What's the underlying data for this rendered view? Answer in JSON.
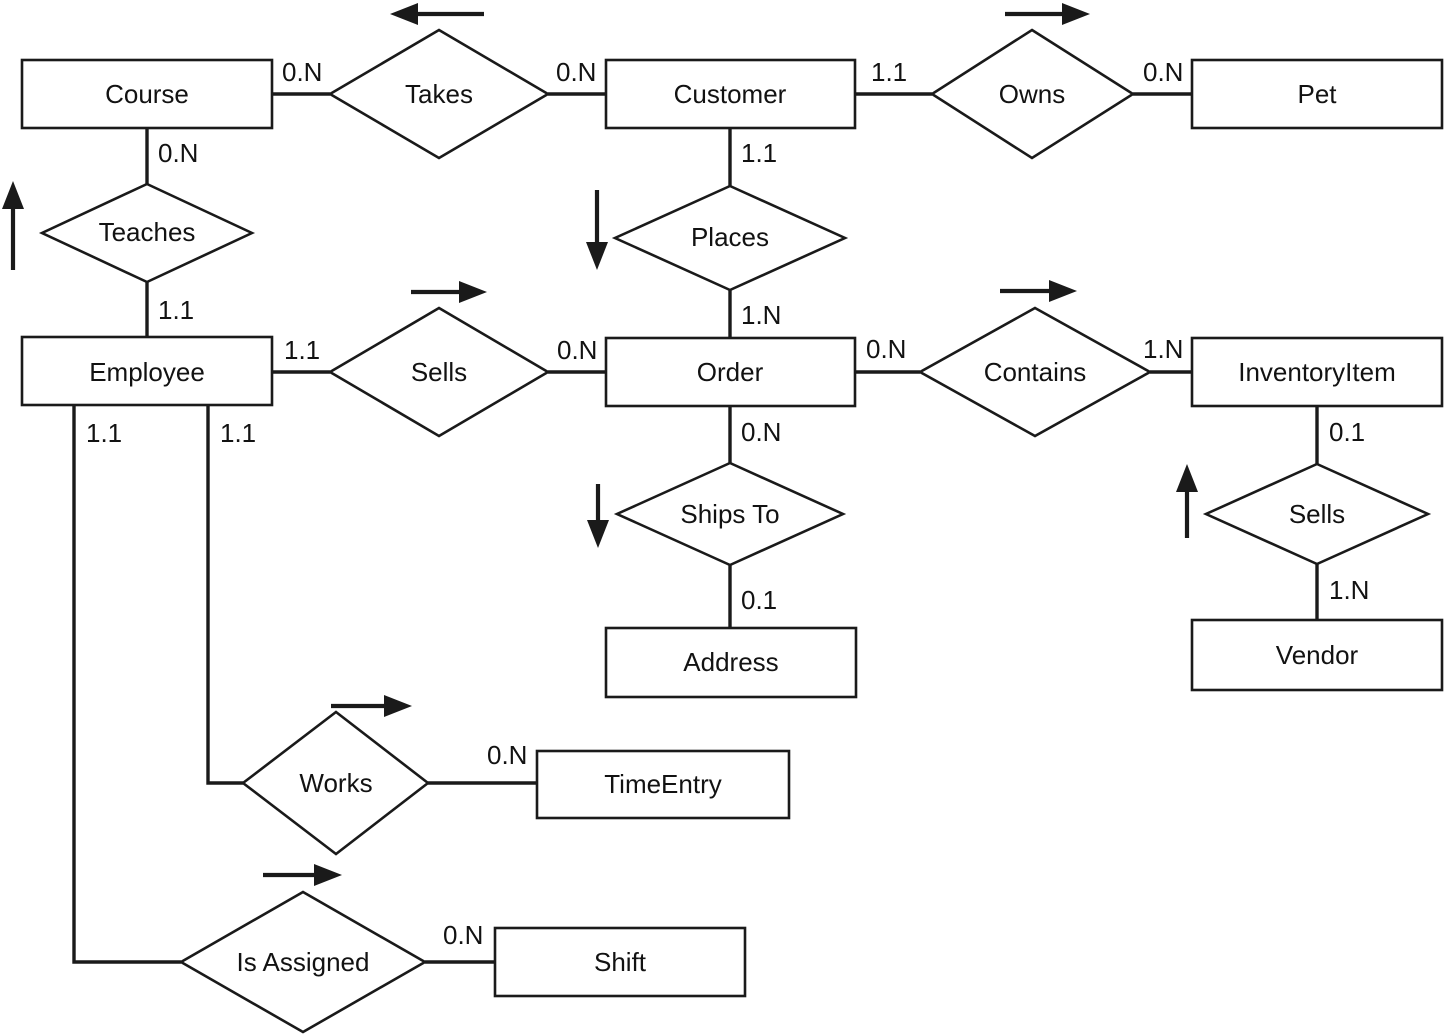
{
  "diagram": {
    "kind": "entity-relationship-diagram",
    "notation": "Chen / min.max cardinality",
    "stroke_color": "#1a1a1a",
    "text_color": "#121212",
    "background_color": "#ffffff",
    "entities": [
      {
        "id": "course",
        "label": "Course"
      },
      {
        "id": "customer",
        "label": "Customer"
      },
      {
        "id": "pet",
        "label": "Pet"
      },
      {
        "id": "employee",
        "label": "Employee"
      },
      {
        "id": "order",
        "label": "Order"
      },
      {
        "id": "inventoryitem",
        "label": "InventoryItem"
      },
      {
        "id": "address",
        "label": "Address"
      },
      {
        "id": "vendor",
        "label": "Vendor"
      },
      {
        "id": "timeentry",
        "label": "TimeEntry"
      },
      {
        "id": "shift",
        "label": "Shift"
      }
    ],
    "relationships": [
      {
        "id": "takes",
        "label": "Takes",
        "from": "course",
        "to": "customer",
        "from_card": "0.N",
        "to_card": "0.N",
        "direction": "left"
      },
      {
        "id": "owns",
        "label": "Owns",
        "from": "customer",
        "to": "pet",
        "from_card": "1.1",
        "to_card": "0.N",
        "direction": "right"
      },
      {
        "id": "teaches",
        "label": "Teaches",
        "from": "course",
        "to": "employee",
        "from_card": "0.N",
        "to_card": "1.1",
        "direction": "up"
      },
      {
        "id": "places",
        "label": "Places",
        "from": "customer",
        "to": "order",
        "from_card": "1.1",
        "to_card": "1.N",
        "direction": "down"
      },
      {
        "id": "sells_emp",
        "label": "Sells",
        "from": "employee",
        "to": "order",
        "from_card": "1.1",
        "to_card": "0.N",
        "direction": "right"
      },
      {
        "id": "contains",
        "label": "Contains",
        "from": "order",
        "to": "inventoryitem",
        "from_card": "0.N",
        "to_card": "1.N",
        "direction": "right"
      },
      {
        "id": "ships_to",
        "label": "Ships To",
        "from": "order",
        "to": "address",
        "from_card": "0.N",
        "to_card": "0.1",
        "direction": "down"
      },
      {
        "id": "sells_vend",
        "label": "Sells",
        "from": "inventoryitem",
        "to": "vendor",
        "from_card": "0.1",
        "to_card": "1.N",
        "direction": "up"
      },
      {
        "id": "works",
        "label": "Works",
        "from": "employee",
        "to": "timeentry",
        "from_card": "1.1",
        "to_card": "0.N",
        "direction": "right"
      },
      {
        "id": "is_assigned",
        "label": "Is Assigned",
        "from": "employee",
        "to": "shift",
        "from_card": "1.1",
        "to_card": "0.N",
        "direction": "right"
      }
    ],
    "cardinality_values": [
      "0.N",
      "1.1",
      "1.N",
      "0.1"
    ]
  },
  "labels": {
    "entity": {
      "course": "Course",
      "customer": "Customer",
      "pet": "Pet",
      "employee": "Employee",
      "order": "Order",
      "inventoryitem": "InventoryItem",
      "address": "Address",
      "vendor": "Vendor",
      "timeentry": "TimeEntry",
      "shift": "Shift"
    },
    "relationship": {
      "takes": "Takes",
      "owns": "Owns",
      "teaches": "Teaches",
      "places": "Places",
      "sells_emp": "Sells",
      "contains": "Contains",
      "ships_to": "Ships To",
      "sells_vend": "Sells",
      "works": "Works",
      "is_assigned": "Is Assigned"
    },
    "cardinality": {
      "course_takes": "0.N",
      "takes_customer": "0.N",
      "customer_owns": "1.1",
      "owns_pet": "0.N",
      "course_teaches": "0.N",
      "teaches_employee": "1.1",
      "customer_places": "1.1",
      "places_order": "1.N",
      "employee_sells": "1.1",
      "sells_order": "0.N",
      "order_contains": "0.N",
      "contains_inventoryitem": "1.N",
      "order_shipsto": "0.N",
      "shipsto_address": "0.1",
      "inventoryitem_sells": "0.1",
      "sells_vendor": "1.N",
      "employee_works": "1.1",
      "works_timeentry": "0.N",
      "employee_isassigned": "1.1",
      "isassigned_shift": "0.N"
    }
  }
}
